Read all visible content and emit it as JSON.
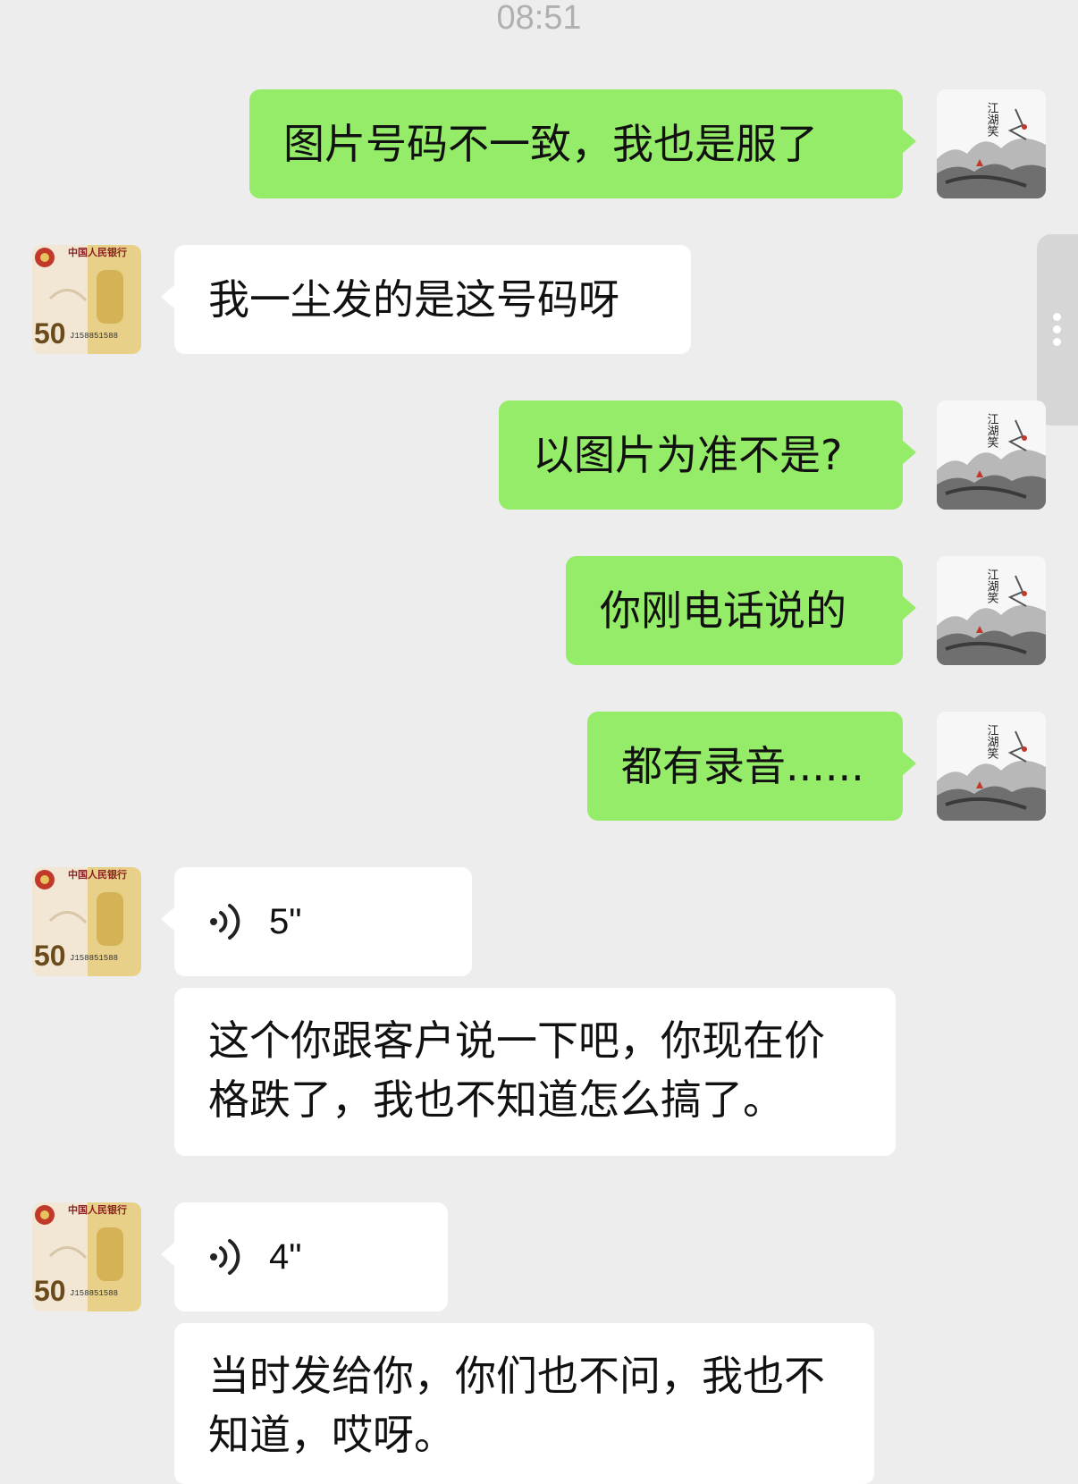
{
  "chat": {
    "timestamp": "08:51",
    "messages": [
      {
        "sender": "me",
        "type": "text",
        "text": "图片号码不一致，我也是服了"
      },
      {
        "sender": "other",
        "type": "text",
        "text": "我一尘发的是这号码呀"
      },
      {
        "sender": "me",
        "type": "text",
        "text": "以图片为准不是?"
      },
      {
        "sender": "me",
        "type": "text",
        "text": "你刚电话说的"
      },
      {
        "sender": "me",
        "type": "text",
        "text": "都有录音......"
      },
      {
        "sender": "other",
        "type": "voice",
        "duration": "5\""
      },
      {
        "sender": "other",
        "type": "text",
        "text": "这个你跟客户说一下吧，你现在价格跌了，我也不知道怎么搞了。"
      },
      {
        "sender": "other",
        "type": "voice",
        "duration": "4\""
      },
      {
        "sender": "other",
        "type": "text",
        "text": "当时发给你，你们也不问，我也不知道，哎呀。"
      }
    ]
  },
  "avatars": {
    "me": {
      "description": "ink-wash landscape painting",
      "text": "江湖笑"
    },
    "other": {
      "description": "50 yuan commemorative banknote",
      "header_text": "中国人民银行",
      "denomination": "50",
      "serial": "J158851588"
    }
  },
  "icons": {
    "voice": "voice-wave-icon",
    "more": "more-vertical-icon"
  },
  "colors": {
    "background": "#ededed",
    "me_bubble": "#95ec69",
    "other_bubble": "#ffffff",
    "timestamp": "#b0b0b0"
  }
}
